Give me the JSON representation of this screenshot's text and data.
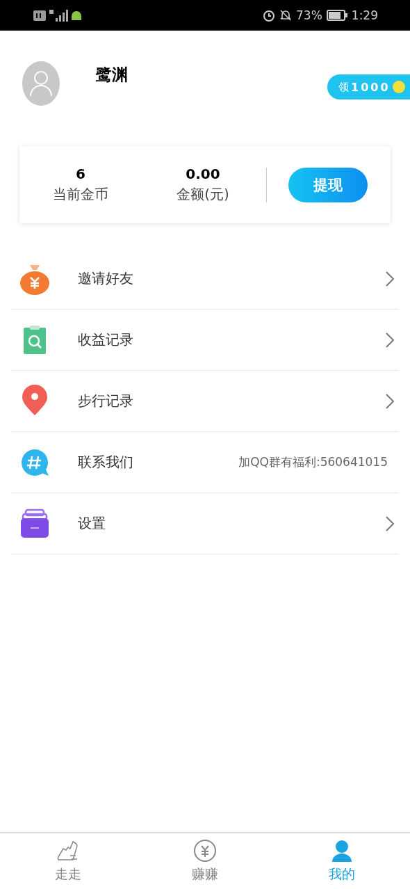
{
  "status_bar": {
    "battery_percent": "73%",
    "time": "1:29"
  },
  "profile": {
    "name": "鹭渊",
    "badge": {
      "label": "领",
      "amount": "1000"
    }
  },
  "wallet": {
    "stats": [
      {
        "value": "6",
        "label": "当前金币"
      },
      {
        "value": "0.00",
        "label": "金额(元)"
      }
    ],
    "button": "提现"
  },
  "menu": [
    {
      "kind": "link",
      "label": "邀请好友"
    },
    {
      "kind": "link",
      "label": "收益记录"
    },
    {
      "kind": "link",
      "label": "步行记录"
    },
    {
      "kind": "note",
      "label": "联系我们",
      "note": "加QQ群有福利:560641015"
    },
    {
      "kind": "link",
      "label": "设置"
    }
  ],
  "tabs": [
    {
      "label": "走走",
      "selected": false
    },
    {
      "label": "赚赚",
      "selected": false
    },
    {
      "label": "我的",
      "selected": true
    }
  ]
}
